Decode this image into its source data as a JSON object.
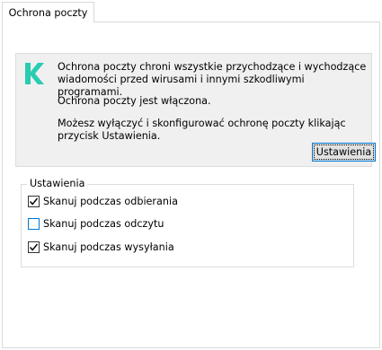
{
  "tab": {
    "label": "Ochrona poczty"
  },
  "info": {
    "description": "Ochrona poczty chroni wszystkie przychodzące i wychodzące wiadomości przed wirusami i innymi szkodliwymi programami.",
    "status": "Ochrona poczty jest włączona.",
    "hint": "Możesz wyłączyć i skonfigurować ochronę poczty klikając przycisk Ustawienia.",
    "settings_button": "Ustawienia",
    "logo_icon": "kaspersky-k-icon",
    "logo_color": "#29ccb1"
  },
  "settings_group": {
    "legend": "Ustawienia",
    "options": [
      {
        "label": "Skanuj podczas odbierania",
        "checked": true
      },
      {
        "label": "Skanuj podczas odczytu",
        "checked": false
      },
      {
        "label": "Skanuj podczas wysyłania",
        "checked": true
      }
    ]
  }
}
